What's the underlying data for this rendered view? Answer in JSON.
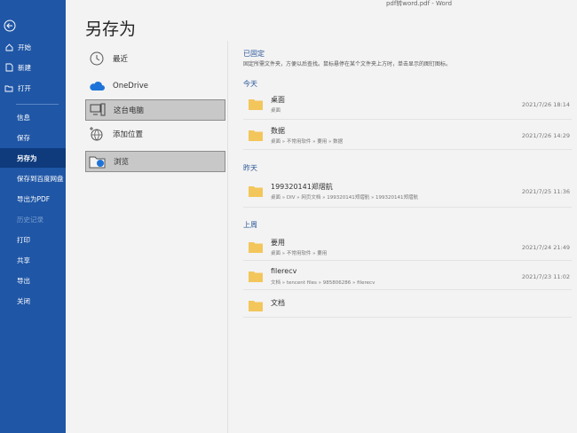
{
  "window": {
    "title": "pdf转word.pdf  -  Word"
  },
  "sidebar": {
    "items": [
      {
        "label": "开始"
      },
      {
        "label": "新建"
      },
      {
        "label": "打开"
      },
      {
        "label": "信息"
      },
      {
        "label": "保存"
      },
      {
        "label": "另存为"
      },
      {
        "label": "保存到百度网盘"
      },
      {
        "label": "导出为PDF"
      },
      {
        "label": "历史记录"
      },
      {
        "label": "打印"
      },
      {
        "label": "共享"
      },
      {
        "label": "导出"
      },
      {
        "label": "关闭"
      }
    ]
  },
  "page": {
    "title": "另存为"
  },
  "locations": [
    {
      "label": "最近"
    },
    {
      "label": "OneDrive"
    },
    {
      "label": "这台电脑"
    },
    {
      "label": "添加位置"
    },
    {
      "label": "浏览"
    }
  ],
  "pinned": {
    "header": "已固定",
    "description": "固定所需文件夹，方便以后查找。鼠标悬停在某个文件夹上方时，单击显示的图钉图标。"
  },
  "groups": [
    {
      "header": "今天",
      "items": [
        {
          "name": "桌面",
          "path": "桌面",
          "date": "2021/7/26 18:14"
        },
        {
          "name": "数据",
          "path": "桌面 » 不常用软件 » 要用 » 数据",
          "date": "2021/7/26 14:29"
        }
      ]
    },
    {
      "header": "昨天",
      "items": [
        {
          "name": "199320141郑熠航",
          "path": "桌面 » DIV » 网页文档 » 199320141郑熠航 » 199320141郑熠航",
          "date": "2021/7/25 11:36"
        }
      ]
    },
    {
      "header": "上周",
      "items": [
        {
          "name": "要用",
          "path": "桌面 » 不常用软件 » 要用",
          "date": "2021/7/24 21:49"
        },
        {
          "name": "filerecv",
          "path": "文档 » tencent files » 985806286 » filerecv",
          "date": "2021/7/23 11:02"
        },
        {
          "name": "文档",
          "path": "",
          "date": ""
        }
      ]
    }
  ],
  "colors": {
    "sidebar": "#1f56a6",
    "sidebar_active": "#0f3b7d",
    "accent": "#2b579a",
    "folder": "#f3c65c"
  }
}
